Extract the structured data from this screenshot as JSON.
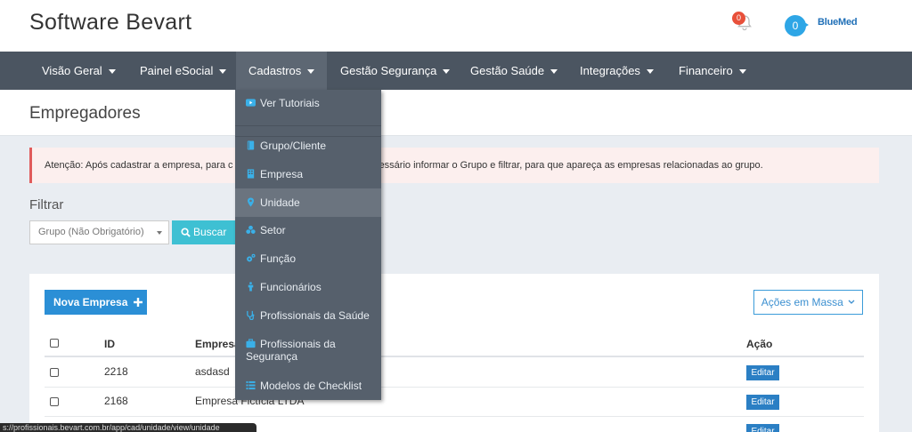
{
  "app": {
    "title": "Software Bevart",
    "notifications_count": "0",
    "user_count": "0",
    "brand": "BlueMed"
  },
  "nav": {
    "items": [
      {
        "label": "Visão Geral"
      },
      {
        "label": "Painel eSocial"
      },
      {
        "label": "Cadastros"
      },
      {
        "label": "Gestão Segurança"
      },
      {
        "label": "Gestão Saúde"
      },
      {
        "label": "Integrações"
      },
      {
        "label": "Financeiro"
      }
    ],
    "active": "Cadastros"
  },
  "dropdown": {
    "items": [
      {
        "label": "Ver Tutoriais",
        "icon": "youtube-icon"
      },
      {
        "label": "Grupo/Cliente",
        "icon": "book-icon"
      },
      {
        "label": "Empresa",
        "icon": "building-icon"
      },
      {
        "label": "Unidade",
        "icon": "map-marker-icon"
      },
      {
        "label": "Setor",
        "icon": "cubes-icon"
      },
      {
        "label": "Função",
        "icon": "cogs-icon"
      },
      {
        "label": "Funcionários",
        "icon": "person-icon"
      },
      {
        "label": "Profissionais da Saúde",
        "icon": "stethoscope-icon"
      },
      {
        "label": "Profissionais da Segurança",
        "icon": "briefcase-icon"
      },
      {
        "label": "Modelos de Checklist",
        "icon": "list-icon"
      }
    ],
    "highlighted": "Unidade"
  },
  "page": {
    "title": "Empregadores",
    "alert_left": "Atenção: Após cadastrar a empresa, para c",
    "alert_right": "essário informar o Grupo e filtrar, para que apareça as empresas relacionadas ao grupo.",
    "filter_label": "Filtrar",
    "group_select": "Grupo (Não Obrigatório)",
    "search_button": "Buscar",
    "new_button": "Nova Empresa",
    "mass_actions": "Ações em Massa"
  },
  "table": {
    "headers": {
      "id": "ID",
      "empresa": "Empresa",
      "acao": "Ação"
    },
    "rows": [
      {
        "id": "2218",
        "empresa": "asdasd",
        "action": "Editar"
      },
      {
        "id": "2168",
        "empresa": "Empresa Fictícia LTDA",
        "action": "Editar"
      },
      {
        "id": "",
        "empresa": "",
        "action": "Editar"
      }
    ]
  },
  "status_bar": {
    "url": "s://profissionais.bevart.com.br/app/cad/unidade/view/unidade"
  },
  "colors": {
    "nav_bg": "#4b5561",
    "dropdown_bg": "#56606c",
    "primary": "#2b8fd6",
    "info": "#3ec0d3",
    "alert_border": "#e05b5b"
  }
}
